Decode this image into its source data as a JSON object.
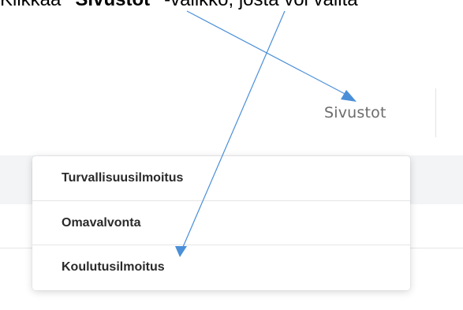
{
  "instruction": {
    "prefix": "Klikkaa ",
    "quoted": "\"Sivustot\"",
    "suffix": " -valikko, josta voi valita"
  },
  "nav": {
    "sivustot_label": "Sivustot"
  },
  "dropdown": {
    "items": [
      {
        "label": "Turvallisuusilmoitus"
      },
      {
        "label": "Omavalvonta"
      },
      {
        "label": "Koulutusilmoitus"
      }
    ]
  },
  "colors": {
    "arrow": "#4a8fd8",
    "nav_text": "#6c6c6c",
    "menu_text": "#2a2a2a",
    "band": "#f3f4f6"
  }
}
